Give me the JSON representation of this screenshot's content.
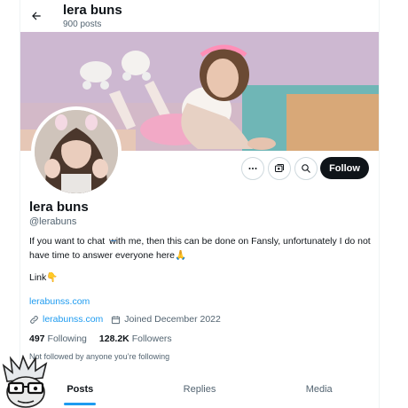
{
  "header": {
    "name": "lera buns",
    "post_count": "900 posts"
  },
  "profile": {
    "display_name": "lera buns",
    "handle": "@lerabuns",
    "bio_before_emoji": "If you want to chat ",
    "bio_after_emoji": " with me, then this can be done on Fansly, unfortunately I do not have time to answer everyone here",
    "bio_link_label": "Link",
    "link_text": "lerabunss.com",
    "website": "lerabunss.com",
    "joined": "Joined December 2022",
    "following_count": "497",
    "following_label": "Following",
    "followers_count": "128.2K",
    "followers_label": "Followers",
    "not_followed": "Not followed by anyone you’re following"
  },
  "actions": {
    "follow_label": "Follow"
  },
  "tabs": [
    {
      "label": "Posts"
    },
    {
      "label": "Replies"
    },
    {
      "label": "Media"
    }
  ],
  "colors": {
    "accent": "#1d9bf0",
    "text": "#0f1419",
    "muted": "#536471"
  },
  "icons": [
    "back-arrow-icon",
    "more-icon",
    "subscribe-icon",
    "search-icon",
    "link-icon",
    "calendar-icon",
    "speech-bubble-emoji",
    "pray-hands-emoji",
    "pointing-down-emoji"
  ]
}
